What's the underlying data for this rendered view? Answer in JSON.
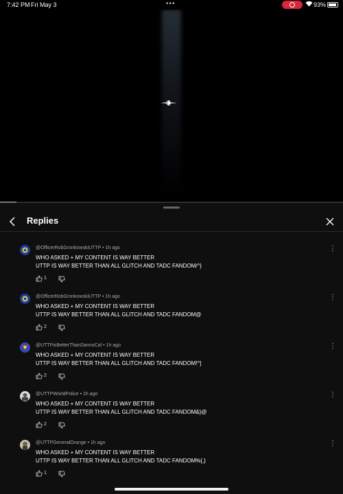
{
  "status_bar": {
    "time": "7:42 PM",
    "date": "Fri May 3",
    "battery": "93%"
  },
  "panel": {
    "title": "Replies"
  },
  "comments": [
    {
      "author": "@OfficerRobGronkowskiUTTP",
      "age": "1h ago",
      "line1": "WHO ASKED + MY CONTENT IS WAY BETTER",
      "line2": "UTTP IS WAY BETTER THAN ALL GLITCH AND TADC FANDOM/^}",
      "likes": "1"
    },
    {
      "author": "@OfficerRobGronkowskiUTTP",
      "age": "1h ago",
      "line1": "WHO ASKED + MY CONTENT IS WAY BETTER",
      "line2": "UTTP IS WAY BETTER THAN ALL GLITCH AND TADC FANDOM@",
      "likes": "2"
    },
    {
      "author": "@UTTPisBetterThanDannoCal",
      "age": "1h ago",
      "line1": "WHO ASKED + MY CONTENT IS WAY BETTER",
      "line2": "UTTP IS WAY BETTER THAN ALL GLITCH AND TADC FANDOM!^]",
      "likes": "2"
    },
    {
      "author": "@UTTPWorldPolice",
      "age": "1h ago",
      "line1": "WHO ASKED + MY CONTENT IS WAY BETTER",
      "line2": "UTTP IS WAY BETTER THAN ALL GLITCH AND TADC FANDOM&}@",
      "likes": "2"
    },
    {
      "author": "@UTTPGeneralOrange",
      "age": "1h ago",
      "line1": "WHO ASKED + MY CONTENT IS WAY BETTER",
      "line2": "UTTP IS WAY BETTER THAN ALL GLITCH AND TADC FANDOM%{,}",
      "likes": "1"
    }
  ]
}
